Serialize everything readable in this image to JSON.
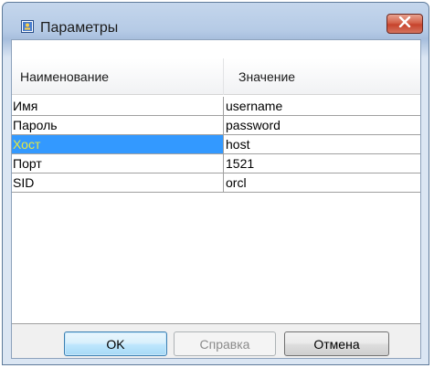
{
  "window": {
    "title": "Параметры",
    "icon": "settings-app-icon",
    "close_icon": "close-icon"
  },
  "table": {
    "columns": [
      "Наименование",
      "Значение"
    ],
    "rows": [
      {
        "name": "Имя",
        "value": "username"
      },
      {
        "name": "Пароль",
        "value": "password"
      },
      {
        "name": "Хост",
        "value": "host",
        "selected": true
      },
      {
        "name": "Порт",
        "value": "1521"
      },
      {
        "name": "SID",
        "value": "orcl"
      }
    ]
  },
  "buttons": {
    "ok": "OK",
    "help": "Справка",
    "cancel": "Отмена"
  },
  "colors": {
    "selection": "#3399ff",
    "selected_text": "#e8e83c",
    "close_button": "#c7432c"
  }
}
